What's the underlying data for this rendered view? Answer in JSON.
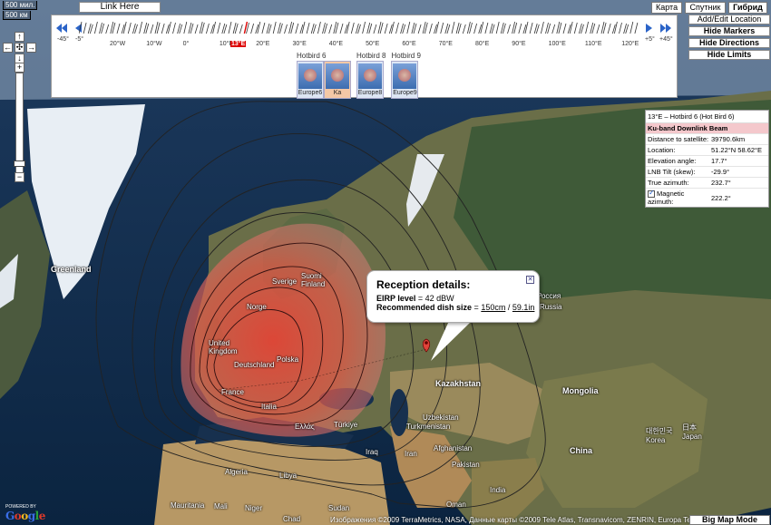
{
  "scale": {
    "top": "500 мил.",
    "bottom": "500 км"
  },
  "link_here": "Link Here",
  "map_types": [
    "Карта",
    "Спутник",
    "Гибрид"
  ],
  "satellite_ruler": {
    "left_range": [
      "-45°",
      "-5°"
    ],
    "right_range": [
      "+5°",
      "+45°"
    ],
    "degree_labels": [
      "20°W",
      "10°W",
      "0°",
      "10°E",
      "20°E",
      "30°E",
      "40°E",
      "50°E",
      "60°E",
      "70°E",
      "80°E",
      "90°E",
      "100°E",
      "110°E",
      "120°E"
    ],
    "current_position": "13°E"
  },
  "satellites": [
    {
      "name": "Hotbird 6",
      "beams": [
        "Europe6",
        "Ka"
      ]
    },
    {
      "name": "Hotbird 8",
      "beams": [
        "Europe8"
      ]
    },
    {
      "name": "Hotbird 9",
      "beams": [
        "Europe9"
      ]
    }
  ],
  "right_buttons": [
    "Add/Edit Location",
    "Hide Markers",
    "Hide Directions",
    "Hide Limits"
  ],
  "info_panel": {
    "title": "13°E – Hotbird 6 (Hot Bird 6)",
    "beam": "Ku-band Downlink Beam",
    "rows": [
      {
        "key": "Distance to satellite:",
        "value": "39790.6km"
      },
      {
        "key": "Location:",
        "value": "51.22°N 58.62°E"
      },
      {
        "key": "Elevation angle:",
        "value": "17.7°"
      },
      {
        "key": "LNB Tilt (skew):",
        "value": "-29.9°"
      },
      {
        "key": "True azimuth:",
        "value": "232.7°"
      },
      {
        "key": "Magnetic azimuth:",
        "value": "222.2°"
      }
    ]
  },
  "reception": {
    "title": "Reception details:",
    "eirp_label": "EIRP level",
    "eirp_value": "= 42 dBW",
    "dish_label": "Recommended dish size",
    "dish_eq": "=",
    "dish_cm": "150cm",
    "dish_sep": "/",
    "dish_in": "59.1in",
    "close": "✕"
  },
  "map_labels": {
    "greenland": "Greenland",
    "suomi": "Suomi Finland",
    "sverige": "Sverige",
    "norge": "Norge",
    "uk": "United Kingdom",
    "deutschland": "Deutschland",
    "polska": "Polska",
    "france": "France",
    "italia": "Italia",
    "turkiye": "Türkiye",
    "ellas": "Ελλάς",
    "rossiya": "Россия",
    "russia": "Russia",
    "kazakhstan": "Kazakhstan",
    "uzbekistan": "Uzbekistan",
    "turkmenistan": "Turkmenistan",
    "iraq": "Iraq",
    "iran": "Iran",
    "afghanistan": "Afghanistan",
    "pakistan": "Pakistan",
    "india": "India",
    "mongolia": "Mongolia",
    "china": "China",
    "japan": "日本 Japan",
    "korea": "대한민국 Korea",
    "algeria": "Algeria",
    "libya": "Libya",
    "mali": "Mali",
    "mauritania": "Mauritania",
    "niger": "Niger",
    "chad": "Chad",
    "sudan": "Sudan",
    "oman": "Oman"
  },
  "footer": {
    "copyright": "Изображения ©2009 TerraMetrics, NASA, Данные карты ©2009 Tele Atlas, Transnavicom, ZENRIN, Europa Technologies",
    "powered_by": "POWERED BY",
    "google": "Google",
    "big_map": "Big Map Mode"
  },
  "colors": {
    "beam_core": "#e8281e",
    "beam_edge": "#f07870",
    "ocean": "#0d2a4a",
    "current_marker": "#dd0000"
  }
}
